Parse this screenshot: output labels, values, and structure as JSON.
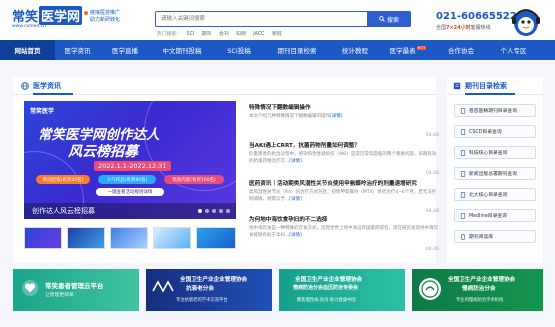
{
  "header": {
    "logo_main": "常笑",
    "logo_box": "医学网",
    "logo_url": "www.cxmed.cn",
    "slogan_line1": "链接医技推广",
    "slogan_line2": "助力新研转化",
    "search_placeholder": "请输入关键词搜索",
    "search_button": "搜索",
    "hot_label": "热门搜索：",
    "hot_terms": [
      "SCI",
      "期刊",
      "会刊",
      "知网",
      "JACC",
      "新冠"
    ],
    "phone": "021-60665522-3",
    "phone_sub_prefix": "全国",
    "phone_sub_em": "7×24小时",
    "phone_sub_suffix": "客服热线"
  },
  "nav": {
    "items": [
      {
        "label": "网站首页",
        "active": true
      },
      {
        "label": "医学资讯",
        "active": false
      },
      {
        "label": "医学直播",
        "active": false
      },
      {
        "label": "中文期刊投稿",
        "active": false
      },
      {
        "label": "SCI投稿",
        "active": false
      },
      {
        "label": "期刊目录检索",
        "active": false
      },
      {
        "label": "统计教程",
        "active": false
      },
      {
        "label": "医学最表",
        "active": false,
        "badge": "HOT"
      },
      {
        "label": "合作协会",
        "active": false
      },
      {
        "label": "个人专区",
        "active": false
      }
    ]
  },
  "news_section": {
    "title": "医学资讯",
    "banner": {
      "logo": "常笑医学",
      "headline1": "常笑医学网创作达人",
      "headline2": "风云榜招募",
      "date": "2022.1.1-2022.12.31",
      "pill1": "原创佳作(有奖40名)",
      "pill2": "人气作品(有奖80名)",
      "pill3": "优质内容(有奖100名)",
      "cta": "一键查看活动规则详情",
      "caption": "创作达人风云榜招募"
    },
    "articles": [
      {
        "title": "特殊情况下翻数编辑操作",
        "desc": "本文介绍几种特殊情况下翻数编辑的操作",
        "more": "[详情]",
        "date": "04-28"
      },
      {
        "title": "当AKI遇上CRRT，抗菌药物剂量如何调整？",
        "desc": "危重患者的抗治过程中，感染和急性肾损伤（AKI）是常见常常面临的两个重要问题，早期有效的抗菌药物治疗可...",
        "more": "[详情]",
        "date": "04-28"
      },
      {
        "title": "医药资讯｜活动期类风湿性关节炎使用甲氨蝶呤治疗的剂量递增研究",
        "desc": "类风湿性关节炎（RA）的治疗方式包括：初始甲氨蝶呤（MTX）单药治疗4~6个月，若无法控制病情，则需诊予...",
        "more": "[详情]",
        "date": "04-28"
      },
      {
        "title": "为何地中海饮食孕妇的不二选择",
        "desc": "地中海饮食是一种特殊的饮食方式，因而世界上地中海沿岸国家而得名，现在研究发现地中海饮食能够有助于孕妇...",
        "more": "[详情]",
        "date": "04-26"
      }
    ]
  },
  "journal_section": {
    "title": "期刊目录检索",
    "items": [
      {
        "label": "卷首医精期刊目录查询"
      },
      {
        "label": "CSCD目录查询"
      },
      {
        "label": "科技核心目录查询"
      },
      {
        "label": "新闻出版总署期刊查询"
      },
      {
        "label": "北大核心目录查询"
      },
      {
        "label": "Medline目录查询"
      },
      {
        "label": "期刊阅读库"
      }
    ]
  },
  "ads": [
    {
      "title": "常笑患者管理云平台",
      "sub": "让管理更简单",
      "color": "#1ba58a"
    },
    {
      "title": "全国卫生产业企业管理协会",
      "title2": "抗衰老分会",
      "sub": "专注抗衰老的学术交流平台",
      "color": "#1d3f9b"
    },
    {
      "title": "全国卫生产业企业管理协会",
      "title2": "慢病防治分会血压防治专委会",
      "sub": "聚焦慢性病·防治·助力健康中国",
      "color": "#1ba58a"
    },
    {
      "title": "全国卫生产业企业管理协会",
      "title2": "慢病防治分会",
      "sub": "专业的慢病防治学术机构",
      "color": "#11804a"
    }
  ]
}
